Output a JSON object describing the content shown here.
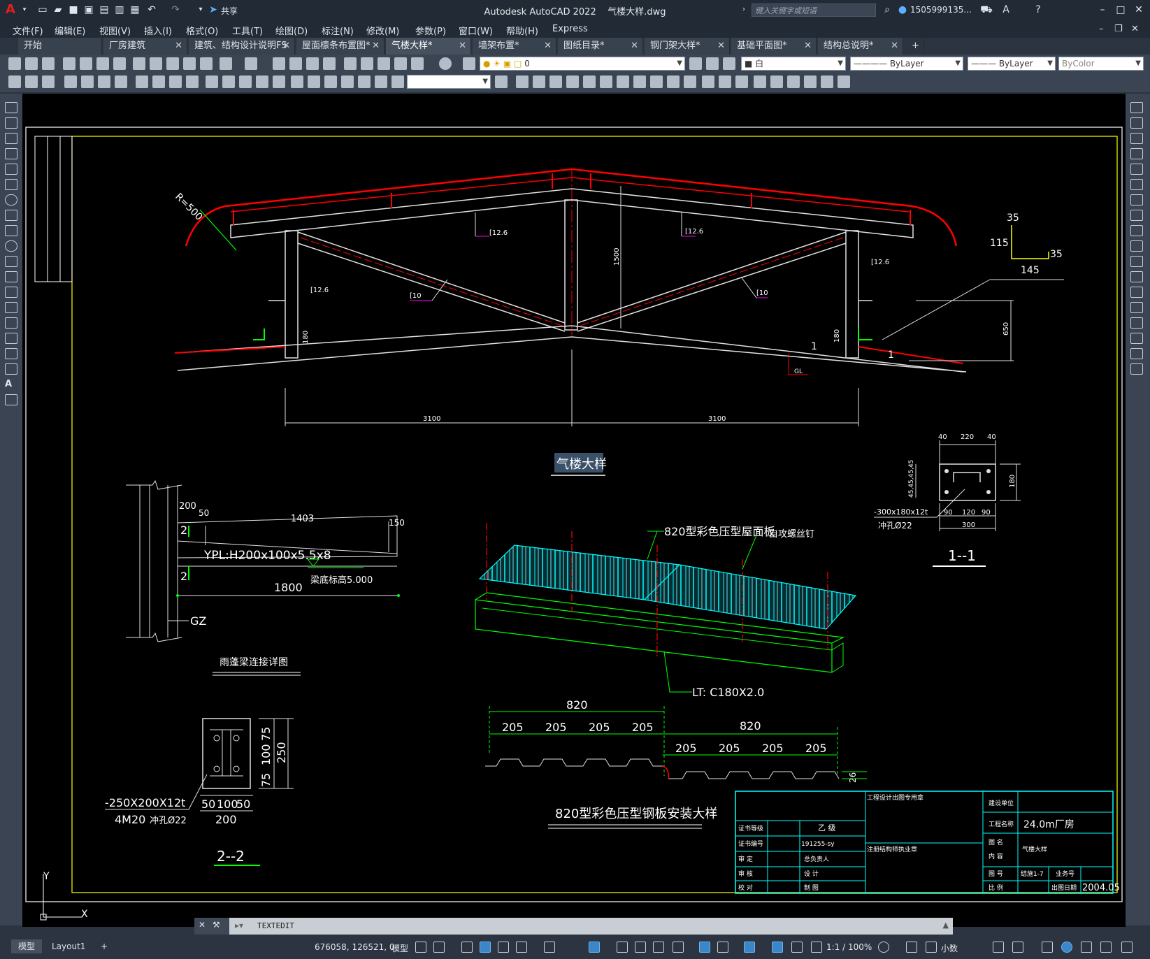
{
  "app": {
    "title": "Autodesk AutoCAD 2022",
    "filename": "气楼大样.dwg",
    "share": "共享",
    "search_placeholder": "键入关键字或短语",
    "user": "1505999135..."
  },
  "menu": [
    "文件(F)",
    "编辑(E)",
    "视图(V)",
    "插入(I)",
    "格式(O)",
    "工具(T)",
    "绘图(D)",
    "标注(N)",
    "修改(M)",
    "参数(P)",
    "窗口(W)",
    "帮助(H)",
    "Express"
  ],
  "tabs": [
    {
      "label": "开始",
      "active": false,
      "closable": false
    },
    {
      "label": "厂房建筑",
      "active": false,
      "closable": true
    },
    {
      "label": "建筑、结构设计说明FS",
      "active": false,
      "closable": true
    },
    {
      "label": "屋面檩条布置图*",
      "active": false,
      "closable": true
    },
    {
      "label": "气楼大样*",
      "active": true,
      "closable": true
    },
    {
      "label": "墙架布置*",
      "active": false,
      "closable": true
    },
    {
      "label": "图纸目录*",
      "active": false,
      "closable": true
    },
    {
      "label": "钢门架大样*",
      "active": false,
      "closable": true
    },
    {
      "label": "基础平面图*",
      "active": false,
      "closable": true
    },
    {
      "label": "结构总说明*",
      "active": false,
      "closable": true
    }
  ],
  "properties": {
    "layer": "0",
    "color": "白",
    "linetype": "ByLayer",
    "lineweight": "ByLayer",
    "plotstyle": "ByColor"
  },
  "drawing": {
    "truss_title": "气楼大样",
    "radius_label": "R=500",
    "member_126": "[12.6",
    "member_10": "[10",
    "dim_1500": "1500",
    "dim_3100": "3100",
    "dim_180": "180",
    "dim_650": "650",
    "slope_1": "1",
    "gl": "GL",
    "angle_35a": "35",
    "angle_115": "115",
    "angle_35b": "35",
    "angle_145": "145",
    "canopy": {
      "title": "雨蓬梁连接详图",
      "d200": "200",
      "d50": "50",
      "d1403": "1403",
      "d150": "150",
      "d2": "2",
      "beam": "YPL:H200x100x5.5x8",
      "elev": "梁底标高5.000",
      "d1800": "1800",
      "gz": "GZ"
    },
    "section22": {
      "title": "2--2",
      "plate": "-250X200X12t",
      "bolts": "4M20",
      "hole": "冲孔Ø22",
      "d75": "75",
      "d100": "100",
      "d250": "250",
      "d50": "50",
      "d200": "200"
    },
    "section11": {
      "title": "1--1",
      "d40": "40",
      "d220": "220",
      "d180": "180",
      "d90": "90",
      "d120": "120",
      "d300": "300",
      "d45": "45,45,45,45",
      "plate": "-300x180x12t",
      "hole": "冲孔Ø22"
    },
    "panel": {
      "title": "820型彩色压型钢板安装大样",
      "label_panel": "820型彩色压型屋面板",
      "label_screw": "自攻螺丝钉",
      "label_lt": "LT: C180X2.0",
      "d820": "820",
      "d205": "205",
      "d26": "26"
    },
    "titleblock": {
      "design_inst": "工程设计出图专用章",
      "build_unit_label": "建设单位",
      "project_label": "工程名称",
      "project": "24.0m厂房",
      "drawing_label": "图 名",
      "content_label": "内 容",
      "drawing_name": "气楼大样",
      "cert_grade_label": "证书等级",
      "cert_grade": "乙 级",
      "cert_no_label": "证书编号",
      "cert_no": "191255-sy",
      "review_label": "审 定",
      "chief_label": "总负责人",
      "check_label": "审 核",
      "design_label": "设 计",
      "proof_label": "校 对",
      "draw_label": "制 图",
      "reg_stamp": "注册结构师执业章",
      "drawing_no_label": "图 号",
      "drawing_no": "结施1-7",
      "biz_label": "业务号",
      "scale_label": "比 例",
      "date_label": "出图日期",
      "date": "2004.05"
    },
    "axis_y": "Y",
    "axis_x": "X"
  },
  "command": {
    "text": "TEXTEDIT"
  },
  "status": {
    "tab_model": "模型",
    "tab_layout": "Layout1",
    "coords": "676058, 126521, 0",
    "space": "模型",
    "scale": "1:1 / 100%",
    "units": "小数"
  },
  "colors": {
    "red": "#ff0000",
    "green": "#00ff00",
    "cyan": "#00ffff",
    "magenta": "#ff00ff",
    "yellow": "#ffff00",
    "white": "#ffffff"
  }
}
